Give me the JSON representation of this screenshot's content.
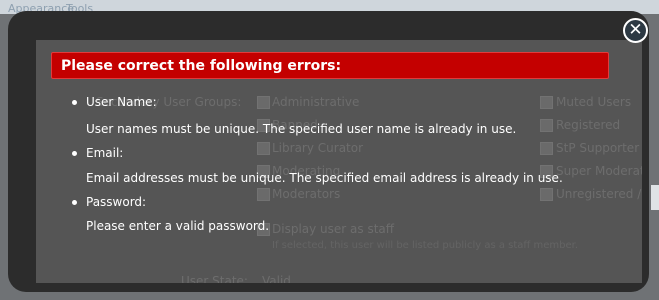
{
  "background_page": {
    "tabs": [
      "Appearance",
      "Tools"
    ],
    "secondary_groups_label": "Secondary User Groups:",
    "groups_left": [
      "Administrative",
      "Banned",
      "Library Curator",
      "Moderating",
      "Moderators"
    ],
    "groups_right": [
      "Muted Users",
      "Registered",
      "StP Supporter",
      "Super Moderators",
      "Unregistered / Unconfirmed"
    ],
    "staff_checkbox_label": "Display user as staff",
    "staff_note": "If selected, this user will be listed publicly as a staff member.",
    "user_state_label": "User State:",
    "user_state_value": "Valid"
  },
  "dialog": {
    "title": "Please correct the following errors:",
    "errors": [
      {
        "field": "User Name:",
        "message": "User names must be unique. The specified user name is already in use."
      },
      {
        "field": "Email:",
        "message": "Email addresses must be unique. The specified email address is already in use."
      },
      {
        "field": "Password:",
        "message": "Please enter a valid password."
      }
    ],
    "close_icon": "close-icon"
  },
  "colors": {
    "banner": "#c40000",
    "overlay_frame": "#2c2c2c",
    "overlay_inner": "#555555",
    "close_button": "#2d3943"
  }
}
